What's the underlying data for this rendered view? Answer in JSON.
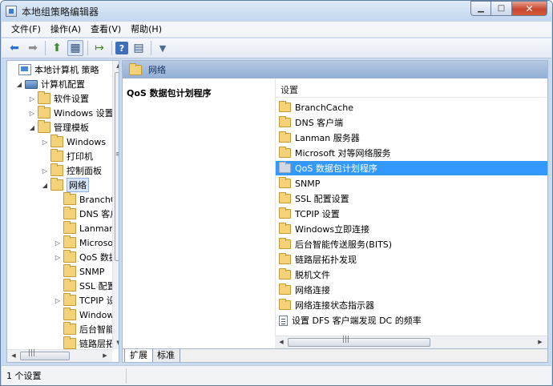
{
  "window": {
    "title": "本地组策略编辑器",
    "minimize": "▁",
    "maximize": "□",
    "close": "✕"
  },
  "menu": [
    "文件(F)",
    "操作(A)",
    "查看(V)",
    "帮助(H)"
  ],
  "toolbar": {
    "back": "⬅",
    "forward": "➡",
    "up": "⬆",
    "show_hide": "▦",
    "export": "↦",
    "help": "?",
    "properties": "▤",
    "filter": "▼"
  },
  "tree": [
    {
      "label": "本地计算机 策略",
      "icon": "policy-icon",
      "expander": ""
    },
    {
      "label": "计算机配置",
      "icon": "computer-icon",
      "expander": "◢"
    },
    {
      "label": "软件设置",
      "icon": "folder-icon",
      "expander": "▷"
    },
    {
      "label": "Windows 设置",
      "icon": "folder-icon",
      "expander": "▷"
    },
    {
      "label": "管理模板",
      "icon": "folder-icon",
      "expander": "◢"
    },
    {
      "label": "Windows",
      "icon": "folder-icon",
      "expander": "▷"
    },
    {
      "label": "打印机",
      "icon": "folder-icon",
      "expander": ""
    },
    {
      "label": "控制面板",
      "icon": "folder-icon",
      "expander": "▷"
    },
    {
      "label": "网络",
      "icon": "folder-icon",
      "expander": "◢"
    },
    {
      "label": "BranchCache",
      "icon": "folder-icon",
      "expander": ""
    },
    {
      "label": "DNS 客户端",
      "icon": "folder-icon",
      "expander": ""
    },
    {
      "label": "Lanman 服务器",
      "icon": "folder-icon",
      "expander": ""
    },
    {
      "label": "Microsoft 对等网络服务",
      "icon": "folder-icon",
      "expander": "▷"
    },
    {
      "label": "QoS 数据包计划程序",
      "icon": "folder-icon",
      "expander": "▷"
    },
    {
      "label": "SNMP",
      "icon": "folder-icon",
      "expander": ""
    },
    {
      "label": "SSL 配置设置",
      "icon": "folder-icon",
      "expander": ""
    },
    {
      "label": "TCPIP 设置",
      "icon": "folder-icon",
      "expander": "▷"
    },
    {
      "label": "Windows立即连接",
      "icon": "folder-icon",
      "expander": ""
    },
    {
      "label": "后台智能传送服务(BITS)",
      "icon": "folder-icon",
      "expander": ""
    },
    {
      "label": "链路层拓扑发现",
      "icon": "folder-icon",
      "expander": ""
    }
  ],
  "right_pane": {
    "header": "网络",
    "description_title": "QoS 数据包计划程序",
    "column_header": "设置",
    "items": [
      {
        "label": "BranchCache",
        "type": "folder"
      },
      {
        "label": "DNS 客户端",
        "type": "folder"
      },
      {
        "label": "Lanman 服务器",
        "type": "folder"
      },
      {
        "label": "Microsoft 对等网络服务",
        "type": "folder"
      },
      {
        "label": "QoS 数据包计划程序",
        "type": "folder",
        "selected": true
      },
      {
        "label": "SNMP",
        "type": "folder"
      },
      {
        "label": "SSL 配置设置",
        "type": "folder"
      },
      {
        "label": "TCPIP 设置",
        "type": "folder"
      },
      {
        "label": "Windows立即连接",
        "type": "folder"
      },
      {
        "label": "后台智能传送服务(BITS)",
        "type": "folder"
      },
      {
        "label": "链路层拓扑发现",
        "type": "folder"
      },
      {
        "label": "脱机文件",
        "type": "folder"
      },
      {
        "label": "网络连接",
        "type": "folder"
      },
      {
        "label": "网络连接状态指示器",
        "type": "folder"
      },
      {
        "label": "设置 DFS 客户端发现 DC 的频率",
        "type": "setting"
      }
    ],
    "tabs": [
      "扩展",
      "标准"
    ]
  },
  "scroll": {
    "up": "▲",
    "down": "▼",
    "left": "◀",
    "right": "▶",
    "grip_v": "≡",
    "grip_h": "|||"
  },
  "status": {
    "text": "1 个设置"
  }
}
